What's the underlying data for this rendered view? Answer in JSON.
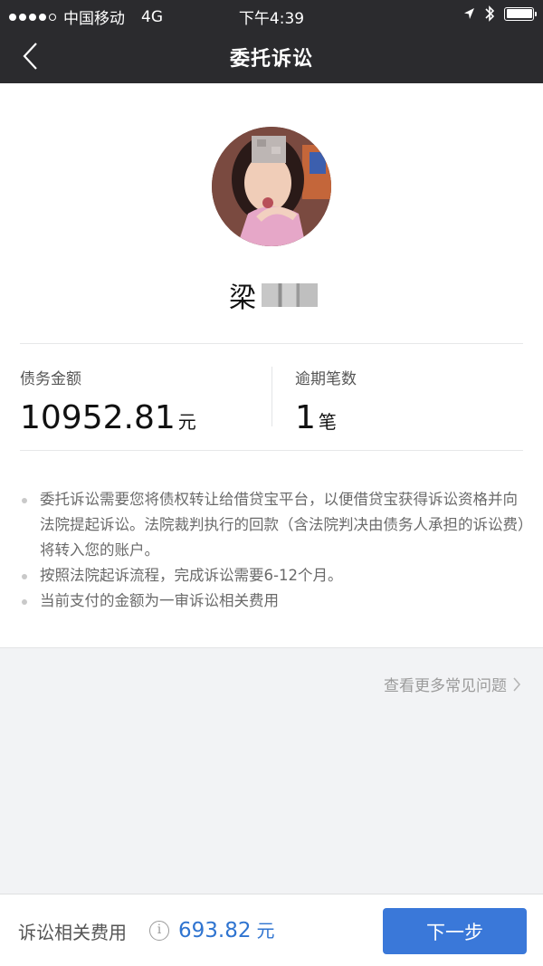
{
  "status_bar": {
    "carrier": "中国移动",
    "network": "4G",
    "time": "下午4:39",
    "icons": [
      "signal-dots-icon",
      "location-arrow-icon",
      "bluetooth-icon",
      "battery-icon"
    ]
  },
  "nav": {
    "title": "委托诉讼",
    "back_icon": "chevron-left-icon"
  },
  "profile": {
    "avatar": "avatar-photo",
    "name": "梁"
  },
  "stats": {
    "debt_label": "债务金额",
    "debt_value": "10952.81",
    "debt_unit": "元",
    "overdue_label": "逾期笔数",
    "overdue_value": "1",
    "overdue_unit": "笔"
  },
  "notes": [
    "委托诉讼需要您将债权转让给借贷宝平台，以便借贷宝获得诉讼资格并向法院提起诉讼。法院裁判执行的回款（含法院判决由债务人承担的诉讼费）将转入您的账户。",
    "按照法院起诉流程，完成诉讼需要6-12个月。",
    "当前支付的金额为一审诉讼相关费用"
  ],
  "faq_link": "查看更多常见问题",
  "footer": {
    "fee_label": "诉讼相关费用",
    "info_icon": "info-circle-icon",
    "fee_amount": "693.82",
    "fee_unit": "元",
    "next_button": "下一步"
  },
  "colors": {
    "nav_bg": "#2b2b2e",
    "accent": "#3a78d9",
    "amount_blue": "#2f74d0",
    "page_bg": "#f2f3f5"
  }
}
